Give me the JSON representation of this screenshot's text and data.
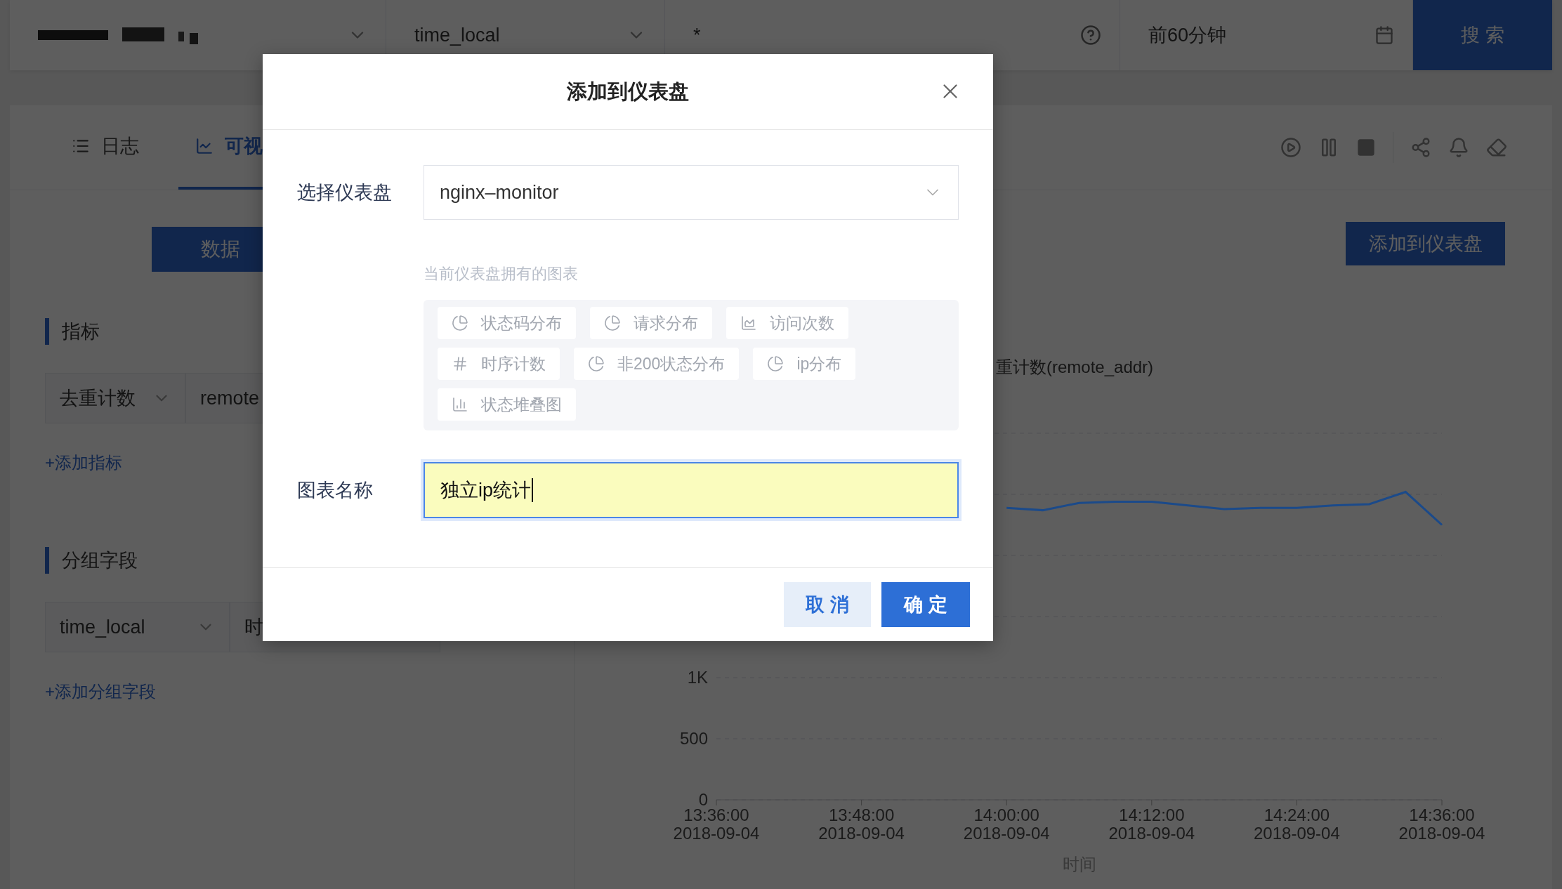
{
  "top_bar": {
    "field_select": "time_local",
    "query": "*",
    "time_range": "前60分钟",
    "search_button": "搜 索"
  },
  "tabs": [
    {
      "label": "日志",
      "kind": "list",
      "selected": false
    },
    {
      "label": "可视",
      "kind": "chart",
      "selected": true
    }
  ],
  "left_panel": {
    "mode_button": "数据",
    "metrics": {
      "title": "指标",
      "function": "去重计数",
      "field": "remote",
      "add_link": "+添加指标"
    },
    "grouping": {
      "title": "分组字段",
      "field": "time_local",
      "value": "时",
      "add_link": "+添加分组字段"
    }
  },
  "add_to_dashboard_button": "添加到仪表盘",
  "chart": {
    "chart_data": {
      "type": "line",
      "xlabel": "时间",
      "categories": [
        "13:36:00\n2018-09-04",
        null,
        null,
        null,
        "13:48:00\n2018-09-04",
        null,
        null,
        null,
        "14:00:00\n2018-09-04",
        null,
        null,
        null,
        "14:12:00\n2018-09-04",
        null,
        null,
        null,
        "14:24:00\n2018-09-04",
        null,
        null,
        null,
        "14:36:00\n2018-09-04"
      ],
      "ylim": [
        0,
        3000
      ],
      "yticks": [
        {
          "value": 0,
          "label": "0"
        },
        {
          "value": 500,
          "label": "500"
        },
        {
          "value": 1000,
          "label": "1K"
        }
      ],
      "series": [
        {
          "name": "重计数(remote_addr)",
          "color": "#1b4a8a",
          "values": [
            null,
            null,
            null,
            null,
            null,
            null,
            null,
            null,
            2390,
            2370,
            2430,
            2440,
            2440,
            2410,
            2380,
            2390,
            2390,
            2410,
            2420,
            2520,
            2250
          ]
        }
      ]
    }
  },
  "dialog": {
    "title": "添加到仪表盘",
    "dashboard_label": "选择仪表盘",
    "dashboard_value": "nginx–monitor",
    "charts_hint": "当前仪表盘拥有的图表",
    "charts": [
      {
        "label": "状态码分布",
        "kind": "pie"
      },
      {
        "label": "请求分布",
        "kind": "pie"
      },
      {
        "label": "访问次数",
        "kind": "area"
      },
      {
        "label": "时序计数",
        "kind": "number"
      },
      {
        "label": "非200状态分布",
        "kind": "pie"
      },
      {
        "label": "ip分布",
        "kind": "pie"
      },
      {
        "label": "状态堆叠图",
        "kind": "bar"
      }
    ],
    "name_label": "图表名称",
    "name_value": "独立ip统计",
    "cancel_button": "取 消",
    "confirm_button": "确 定"
  }
}
